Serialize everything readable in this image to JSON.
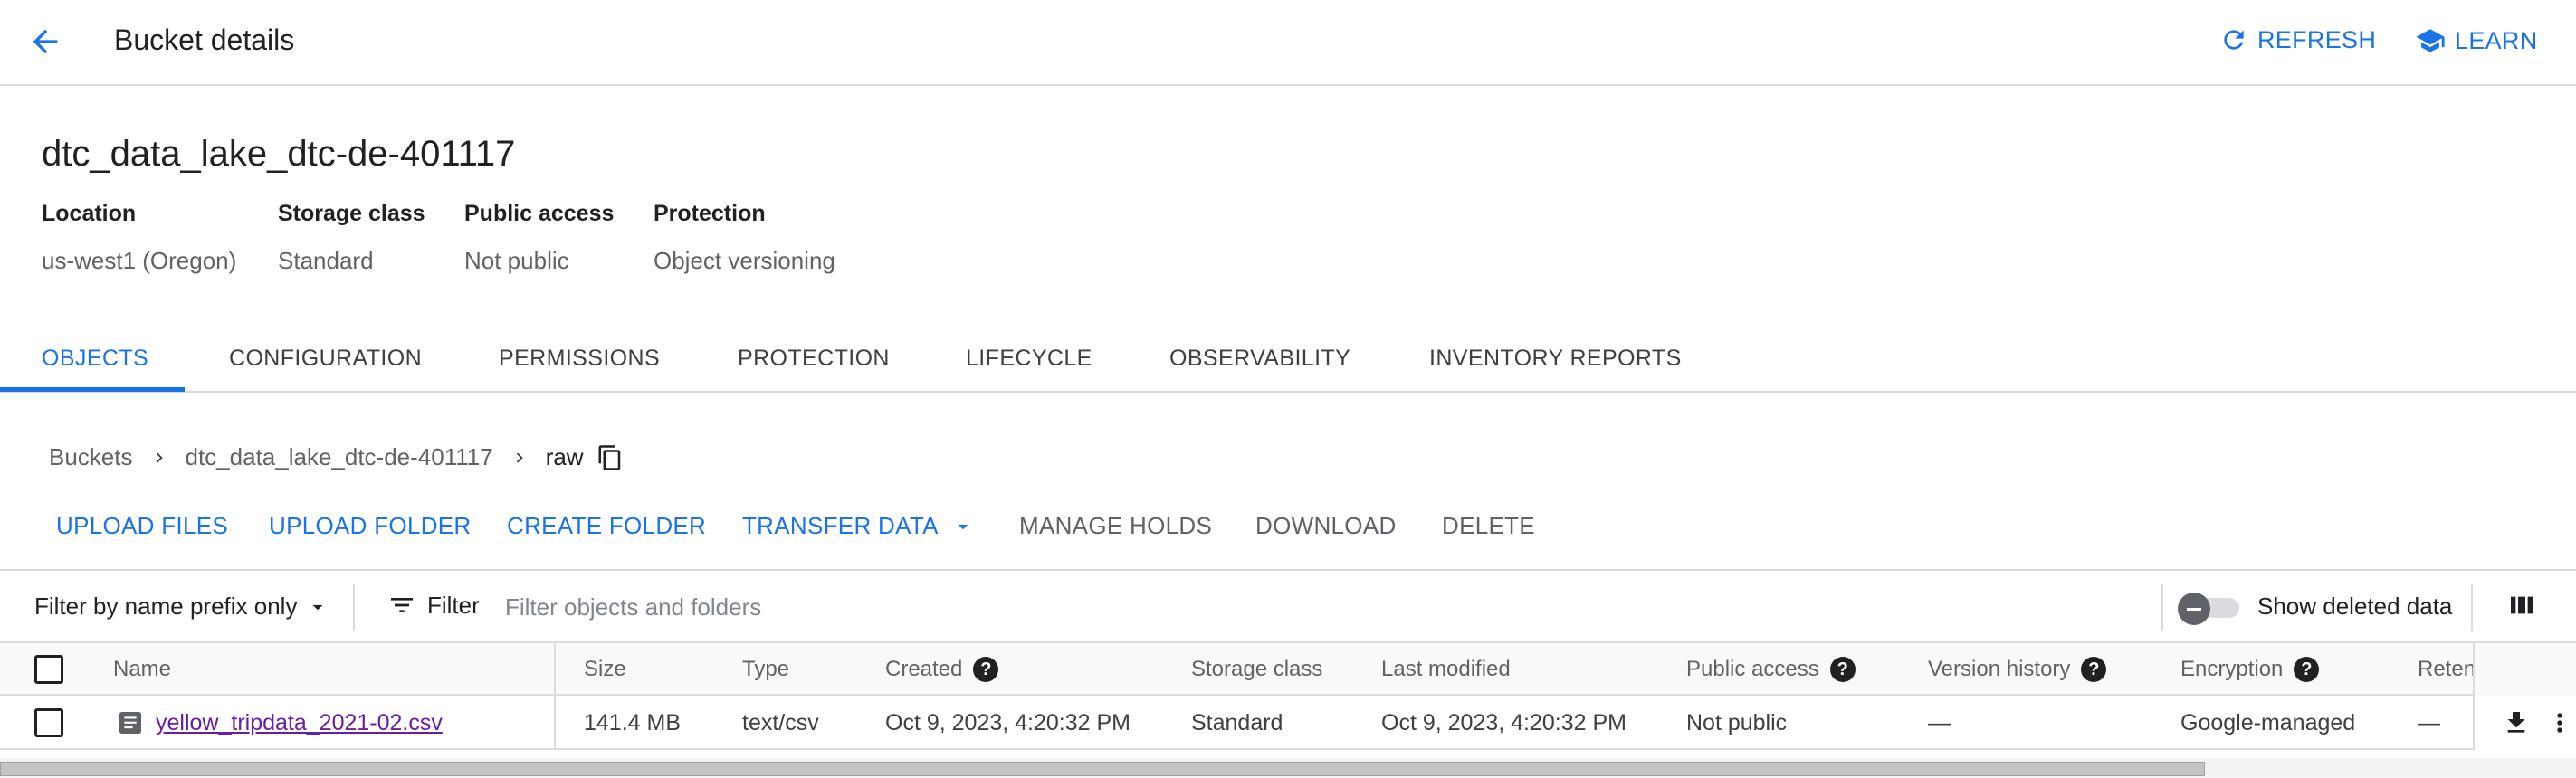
{
  "header": {
    "title": "Bucket details",
    "refresh_label": "REFRESH",
    "learn_label": "LEARN"
  },
  "bucket": {
    "name": "dtc_data_lake_dtc-de-401117",
    "location_label": "Location",
    "location_value": "us-west1 (Oregon)",
    "storage_class_label": "Storage class",
    "storage_class_value": "Standard",
    "public_access_label": "Public access",
    "public_access_value": "Not public",
    "protection_label": "Protection",
    "protection_value": "Object versioning"
  },
  "tabs": [
    {
      "label": "OBJECTS",
      "active": true
    },
    {
      "label": "CONFIGURATION"
    },
    {
      "label": "PERMISSIONS"
    },
    {
      "label": "PROTECTION"
    },
    {
      "label": "LIFECYCLE"
    },
    {
      "label": "OBSERVABILITY"
    },
    {
      "label": "INVENTORY REPORTS"
    }
  ],
  "breadcrumb": {
    "root": "Buckets",
    "bucket": "dtc_data_lake_dtc-de-401117",
    "current": "raw"
  },
  "actions": {
    "upload_files": "UPLOAD FILES",
    "upload_folder": "UPLOAD FOLDER",
    "create_folder": "CREATE FOLDER",
    "transfer_data": "TRANSFER DATA",
    "manage_holds": "MANAGE HOLDS",
    "download": "DOWNLOAD",
    "delete": "DELETE"
  },
  "filter": {
    "prefix_select": "Filter by name prefix only",
    "filter_label": "Filter",
    "placeholder": "Filter objects and folders",
    "show_deleted_label": "Show deleted data"
  },
  "table": {
    "columns": {
      "name": "Name",
      "size": "Size",
      "type": "Type",
      "created": "Created",
      "storage_class": "Storage class",
      "last_modified": "Last modified",
      "public_access": "Public access",
      "version_history": "Version history",
      "encryption": "Encryption",
      "retention": "Reten"
    },
    "rows": [
      {
        "name": "yellow_tripdata_2021-02.csv",
        "size": "141.4 MB",
        "type": "text/csv",
        "created": "Oct 9, 2023, 4:20:32 PM",
        "storage_class": "Standard",
        "last_modified": "Oct 9, 2023, 4:20:32 PM",
        "public_access": "Not public",
        "version_history": "—",
        "encryption": "Google-managed",
        "retention": "—"
      }
    ]
  },
  "colors": {
    "accent": "#1a73e8",
    "link_visited": "#681da8",
    "divider": "#dadce0",
    "text_primary": "#202124",
    "text_secondary": "#5f6368"
  },
  "icons": {
    "back": "arrow-back-icon",
    "refresh": "refresh-icon",
    "learn": "school-icon",
    "copy": "copy-icon",
    "filter": "filter-list-icon",
    "columns": "view-column-icon",
    "file": "file-icon",
    "help": "help-icon",
    "download": "download-icon",
    "more": "more-vert-icon"
  }
}
